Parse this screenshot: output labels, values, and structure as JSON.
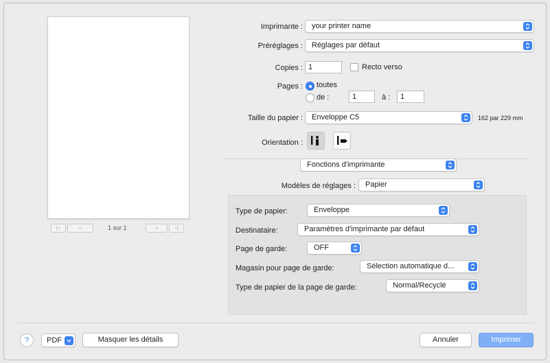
{
  "preview": {
    "page_indicator": "1 sur 1",
    "first_label": "|<",
    "prev_label": "<",
    "next_label": ">",
    "last_label": ">|"
  },
  "printer": {
    "label": "Imprimante :",
    "value": "your printer name"
  },
  "presets": {
    "label": "Préréglages :",
    "value": "Réglages par défaut"
  },
  "copies": {
    "label": "Copies :",
    "value": "1",
    "duplex_label": "Recto verso"
  },
  "pages": {
    "label": "Pages :",
    "all_label": "toutes",
    "from_label": "de :",
    "from_value": "1",
    "to_label": "à :",
    "to_value": "1"
  },
  "paper_size": {
    "label": "Taille du papier :",
    "value": "Enveloppe C5",
    "dimensions": "162 par 229 mm"
  },
  "orientation": {
    "label": "Orientation :"
  },
  "section_menu": {
    "value": "Fonctions d'imprimante"
  },
  "feature_sets": {
    "label": "Modèles de réglages :",
    "value": "Papier"
  },
  "paper_type": {
    "label": "Type de papier:",
    "value": "Enveloppe"
  },
  "destination": {
    "label": "Destinataire:",
    "value": "Paramètres d'imprimante par défaut"
  },
  "cover_page": {
    "label": "Page de garde:",
    "value": "OFF"
  },
  "cover_tray": {
    "label": "Magasin pour page de garde:",
    "value": "Sélection automatique d..."
  },
  "cover_paper_type": {
    "label": "Type de papier de la page de garde:",
    "value": "Normal/Recyclé"
  },
  "footer": {
    "help_label": "?",
    "pdf_label": "PDF",
    "hide_details_label": "Masquer les détails",
    "cancel_label": "Annuler",
    "print_label": "Imprimer"
  },
  "colors": {
    "accent": "#3b82f0",
    "primary_button": "#7fb0f5"
  },
  "icons": {
    "popup_arrow": "updown-chevron-icon",
    "portrait": "portrait-orientation-icon",
    "landscape": "landscape-orientation-icon",
    "help": "help-icon"
  }
}
